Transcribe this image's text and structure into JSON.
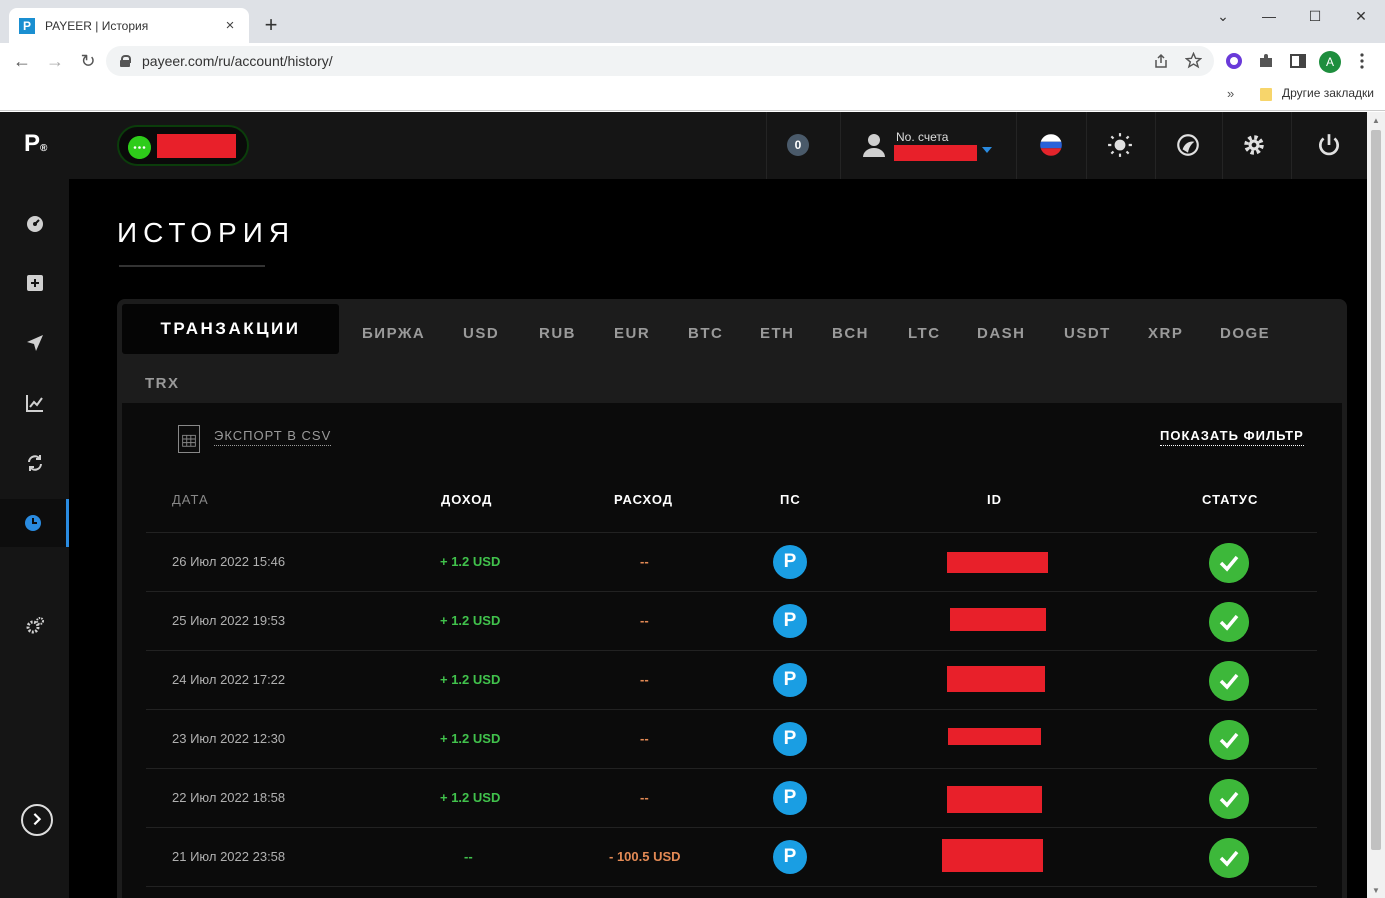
{
  "browser": {
    "tab_title": "PAYEER | История",
    "tab_favicon": "P",
    "tab_close": "×",
    "new_tab": "+",
    "window": {
      "minimize": "—",
      "maximize": "☐",
      "close": "✕",
      "tab_search": "⌄"
    },
    "nav": {
      "back": "←",
      "forward": "→",
      "reload": "↻"
    },
    "url": "payeer.com/ru/account/history/",
    "profile_initial": "A",
    "bookmarks_more": "»",
    "other_bookmarks": "Другие закладки"
  },
  "app": {
    "logo": "P",
    "logo_mark": "®",
    "notifications_count": "0",
    "account_label": "No. счета",
    "page_title": "ИСТОРИЯ",
    "tabs": [
      "ТРАНЗАКЦИИ",
      "БИРЖА",
      "USD",
      "RUB",
      "EUR",
      "BTC",
      "ETH",
      "BCH",
      "LTC",
      "DASH",
      "USDT",
      "XRP",
      "DOGE",
      "TRX"
    ],
    "export_csv": "ЭКСПОРТ В CSV",
    "show_filter": "ПОКАЗАТЬ ФИЛЬТР",
    "columns": {
      "date": "ДАТА",
      "income": "ДОХОД",
      "expense": "РАСХОД",
      "ps": "ПС",
      "id": "ID",
      "status": "СТАТУС"
    },
    "ps_letter": "P",
    "rows": [
      {
        "date": "26 Июл 2022 15:46",
        "income": "+ 1.2 USD",
        "expense": "--"
      },
      {
        "date": "25 Июл 2022 19:53",
        "income": "+ 1.2 USD",
        "expense": "--"
      },
      {
        "date": "24 Июл 2022 17:22",
        "income": "+ 1.2 USD",
        "expense": "--"
      },
      {
        "date": "23 Июл 2022 12:30",
        "income": "+ 1.2 USD",
        "expense": "--"
      },
      {
        "date": "22 Июл 2022 18:58",
        "income": "+ 1.2 USD",
        "expense": "--"
      },
      {
        "date": "21 Июл 2022 23:58",
        "income": "--",
        "expense": "- 100.5 USD"
      }
    ]
  },
  "colors": {
    "accent": "#2a8be0",
    "income": "#41c24c",
    "expense": "#e38a55",
    "status_ok": "#3db83a",
    "redaction": "#e8202a"
  }
}
